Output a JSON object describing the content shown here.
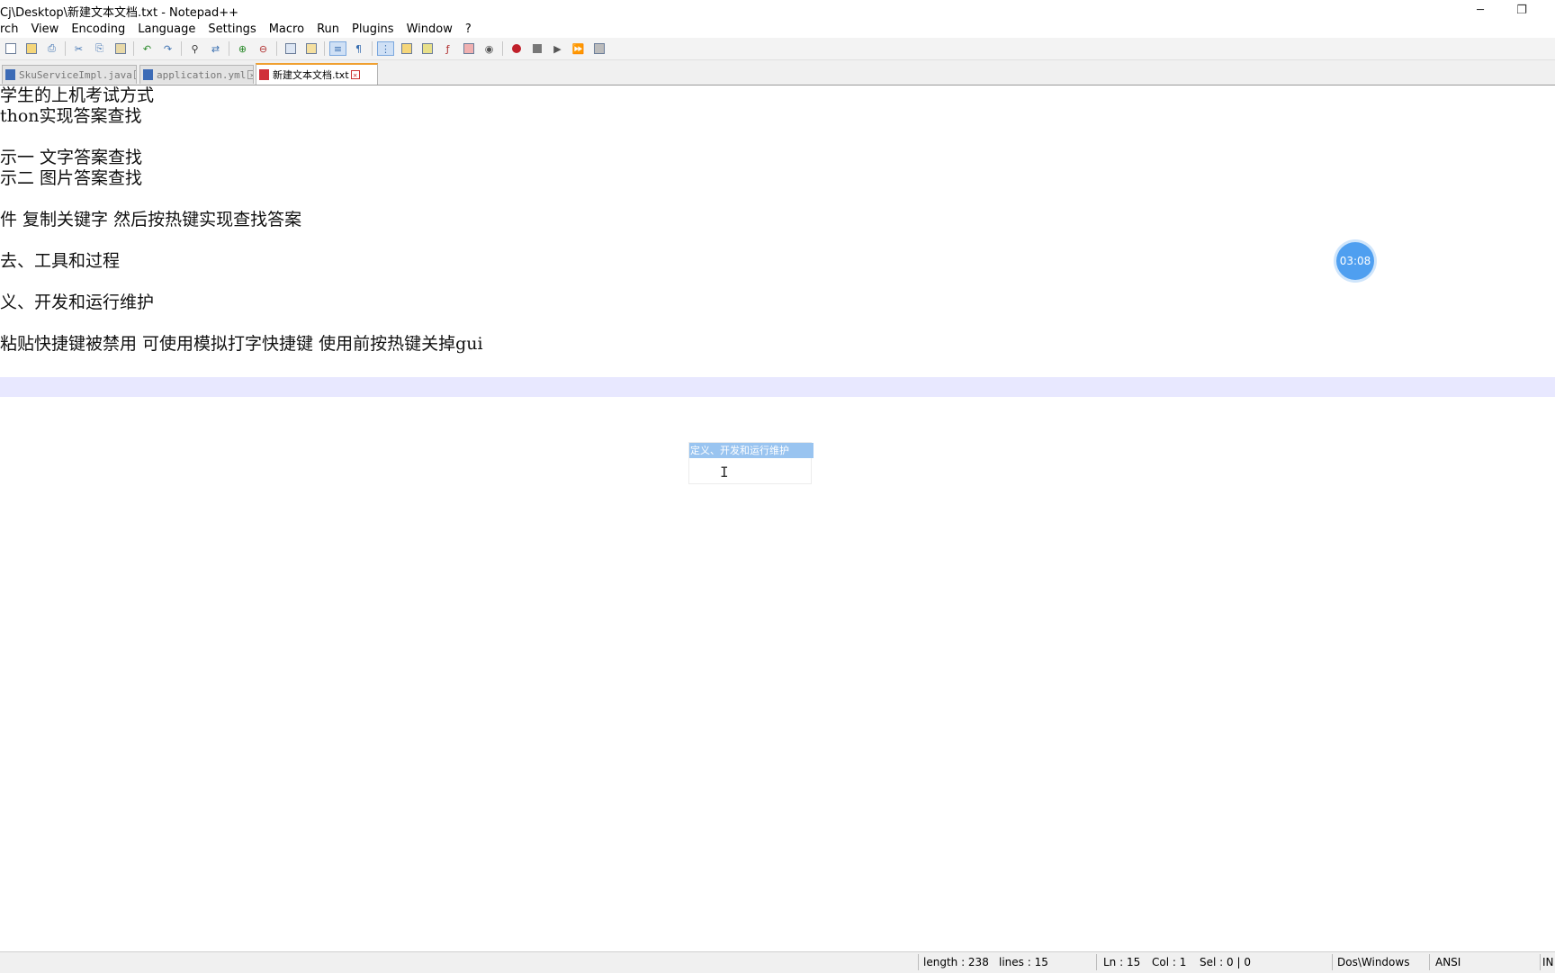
{
  "window": {
    "title": "Cj\\Desktop\\新建文本文档.txt - Notepad++",
    "minimize_glyph": "─",
    "restore_glyph": "❐"
  },
  "menu": [
    "rch",
    "View",
    "Encoding",
    "Language",
    "Settings",
    "Macro",
    "Run",
    "Plugins",
    "Window",
    "?"
  ],
  "toolbar": {
    "icons": [
      "new-file-icon",
      "open-file-icon",
      "save-icon",
      "print-icon",
      "cut-icon",
      "copy-icon",
      "paste-icon",
      "undo-icon",
      "redo-icon",
      "find-icon",
      "replace-icon",
      "zoom-in-icon",
      "zoom-out-icon",
      "sync-vertical-icon",
      "sync-horizontal-icon",
      "word-wrap-icon",
      "show-all-chars-icon",
      "indent-guide-icon",
      "user-language-icon",
      "doc-map-icon",
      "function-list-icon",
      "folder-workspace-icon",
      "monitor-icon",
      "record-macro-icon",
      "stop-macro-icon",
      "play-macro-icon",
      "run-macro-multiple-icon",
      "save-macro-icon"
    ]
  },
  "tabs": [
    {
      "label": "SkuServiceImpl.java",
      "active": false
    },
    {
      "label": "application.yml",
      "active": false
    },
    {
      "label": "新建文本文档.txt",
      "active": true
    }
  ],
  "editor": {
    "lines": [
      "学生的上机考试方式",
      "thon实现答案查找",
      "",
      "示一 文字答案查找",
      "示二 图片答案查找",
      "",
      "件 复制关键字 然后按热键实现查找答案",
      "",
      "去、工具和过程",
      "",
      "义、开发和运行维护",
      "",
      "粘贴快捷键被禁用  可使用模拟打字快捷键 使用前按热键关掉gui",
      "",
      ""
    ],
    "current_line": 15
  },
  "timer": {
    "value": "03:08"
  },
  "ime_popup": {
    "highlight_text": "定义、开发和运行维护",
    "cursor_glyph": "I"
  },
  "statusbar": {
    "length": "length : 238",
    "lines": "lines : 15",
    "ln": "Ln : 15",
    "col": "Col : 1",
    "sel": "Sel : 0 | 0",
    "eol": "Dos\\Windows",
    "encoding": "ANSI",
    "mode": "IN"
  }
}
